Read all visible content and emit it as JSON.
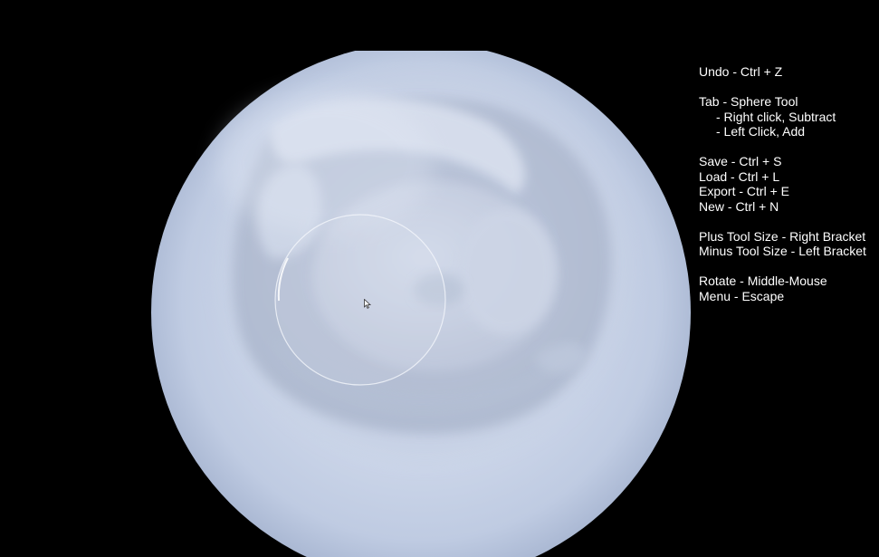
{
  "colors": {
    "background": "#000000",
    "sculpt_base": "#c9d3e6",
    "help_text": "#ffffff"
  },
  "viewport": {
    "object": "sculpt-sphere",
    "tool": "sphere-tool-brush-outline",
    "cursor": "arrow-cursor-icon"
  },
  "help": {
    "undo": "Undo - Ctrl + Z",
    "tab": "Tab - Sphere Tool",
    "right_click": "- Right click, Subtract",
    "left_click": "- Left Click, Add",
    "save": "Save - Ctrl + S",
    "load": "Load - Ctrl + L",
    "export": "Export - Ctrl + E",
    "new": "New - Ctrl + N",
    "plus_tool": "Plus Tool Size - Right Bracket",
    "minus_tool": "Minus Tool Size - Left Bracket",
    "rotate": "Rotate - Middle-Mouse",
    "menu": "Menu - Escape"
  }
}
